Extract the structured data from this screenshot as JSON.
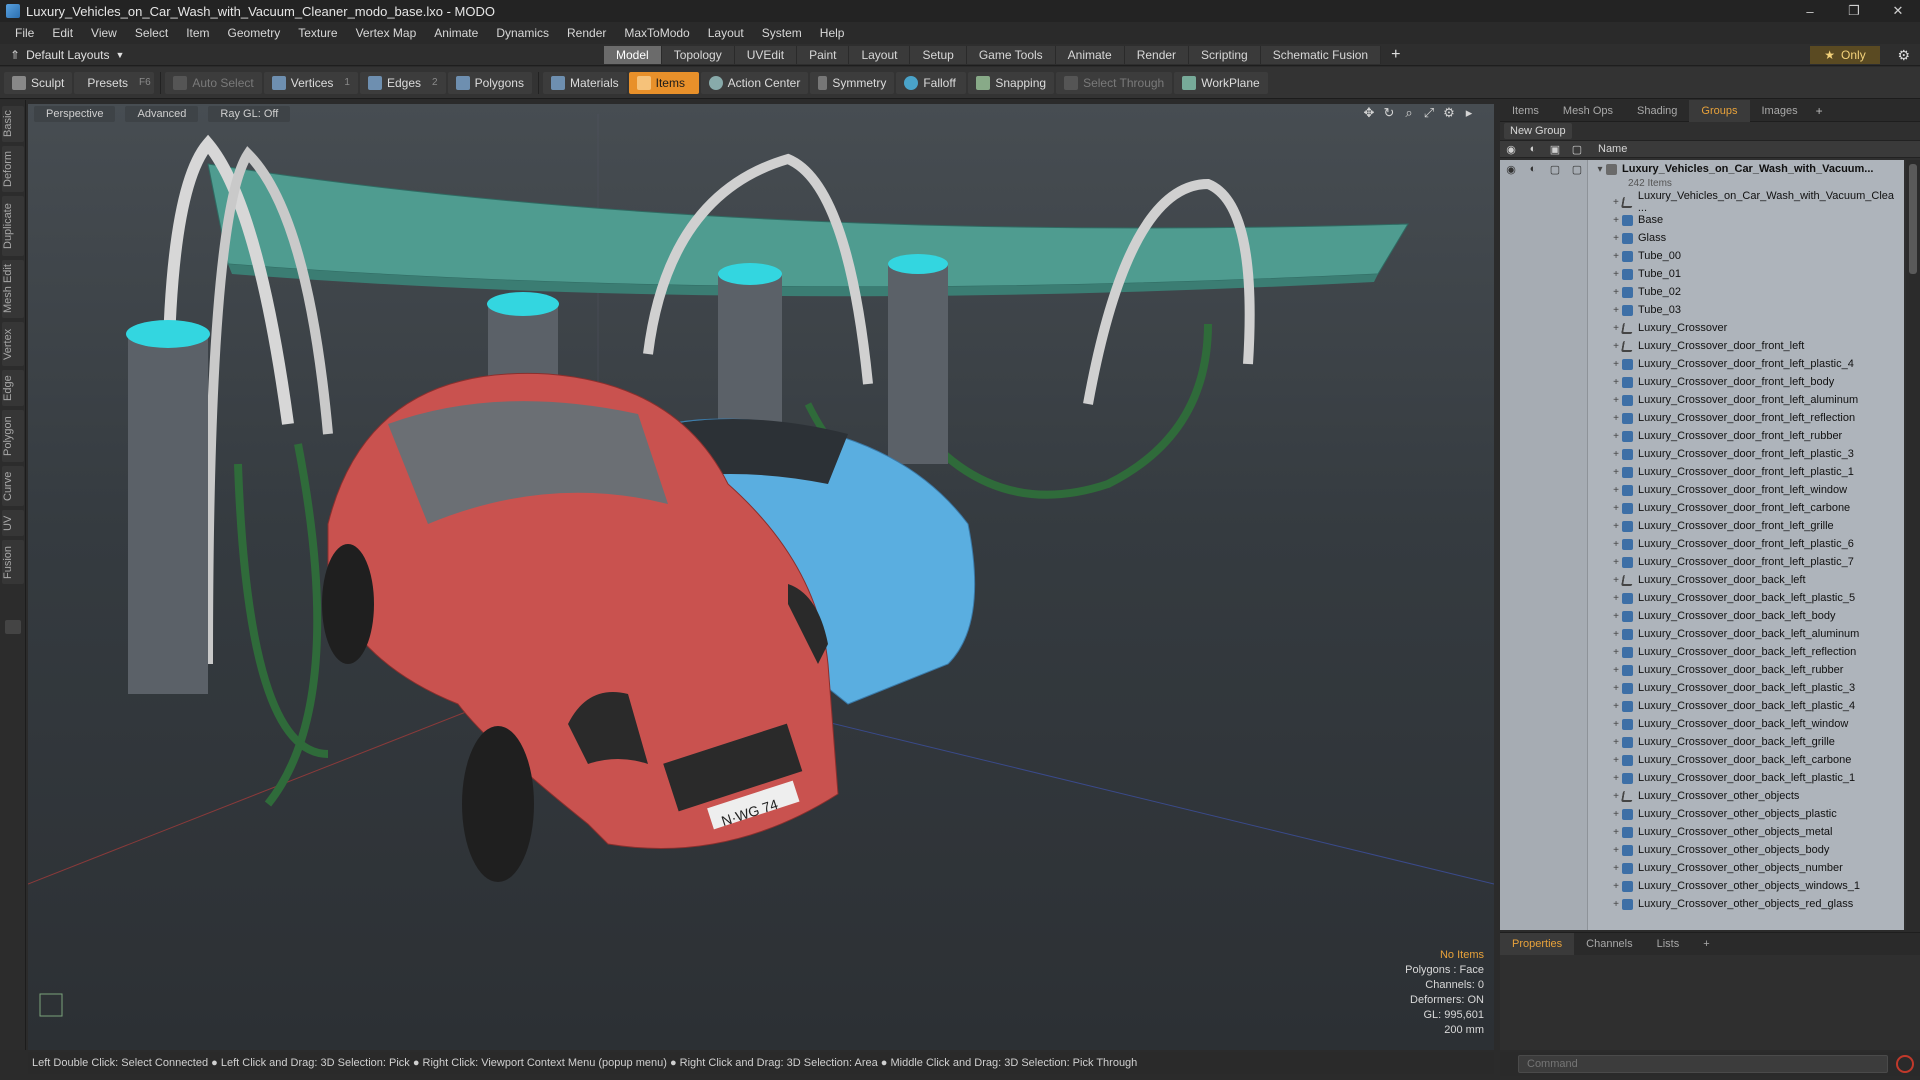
{
  "window": {
    "title": "Luxury_Vehicles_on_Car_Wash_with_Vacuum_Cleaner_modo_base.lxo - MODO",
    "controls": [
      "–",
      "❐",
      "✕"
    ]
  },
  "menu": [
    "File",
    "Edit",
    "View",
    "Select",
    "Item",
    "Geometry",
    "Texture",
    "Vertex Map",
    "Animate",
    "Dynamics",
    "Render",
    "MaxToModo",
    "Layout",
    "System",
    "Help"
  ],
  "layoutbar": {
    "layout_select": "Default Layouts",
    "tabs": [
      "Model",
      "Topology",
      "UVEdit",
      "Paint",
      "Layout",
      "Setup",
      "Game Tools",
      "Animate",
      "Render",
      "Scripting",
      "Schematic Fusion"
    ],
    "active_tab": "Model",
    "plus": "+",
    "only_label": "Only"
  },
  "toolbar": {
    "sculpt": "Sculpt",
    "presets": "Presets",
    "presets_key": "F6",
    "auto_select": "Auto Select",
    "vertices": "Vertices",
    "vertices_key": "1",
    "edges": "Edges",
    "edges_key": "2",
    "polygons": "Polygons",
    "materials": "Materials",
    "items": "Items",
    "action_center": "Action Center",
    "symmetry": "Symmetry",
    "falloff": "Falloff",
    "snapping": "Snapping",
    "select_through": "Select Through",
    "workplane": "WorkPlane"
  },
  "left_tabs": [
    "Basic",
    "Deform",
    "Duplicate",
    "Mesh Edit",
    "Vertex",
    "Edge",
    "Polygon",
    "Curve",
    "UV",
    "Fusion"
  ],
  "viewport": {
    "view_label": "Perspective",
    "shading_label": "Advanced",
    "raygl_label": "Ray GL: Off",
    "info": {
      "no_items": "No Items",
      "polygons": "Polygons : Face",
      "channels": "Channels: 0",
      "deformers": "Deformers: ON",
      "gl": "GL: 995,601",
      "scale": "200 mm"
    },
    "plate_text": "N·WG 74"
  },
  "status_bar": "Left Double Click: Select Connected ● Left Click and Drag: 3D Selection: Pick ● Right Click: Viewport Context Menu (popup menu) ● Right Click and Drag: 3D Selection: Area ● Middle Click and Drag: 3D Selection: Pick Through",
  "right_panel": {
    "tabs": [
      "Items",
      "Mesh Ops",
      "Shading",
      "Groups",
      "Images"
    ],
    "active_tab": "Groups",
    "new_group": "New Group",
    "column_name": "Name",
    "root": "Luxury_Vehicles_on_Car_Wash_with_Vacuum...",
    "root_count": "242 Items",
    "items": [
      {
        "name": "Luxury_Vehicles_on_Car_Wash_with_Vacuum_Clea ...",
        "type": "locator"
      },
      {
        "name": "Base",
        "type": "mesh"
      },
      {
        "name": "Glass",
        "type": "mesh"
      },
      {
        "name": "Tube_00",
        "type": "mesh"
      },
      {
        "name": "Tube_01",
        "type": "mesh"
      },
      {
        "name": "Tube_02",
        "type": "mesh"
      },
      {
        "name": "Tube_03",
        "type": "mesh"
      },
      {
        "name": "Luxury_Crossover",
        "type": "locator"
      },
      {
        "name": "Luxury_Crossover_door_front_left",
        "type": "locator"
      },
      {
        "name": "Luxury_Crossover_door_front_left_plastic_4",
        "type": "mesh"
      },
      {
        "name": "Luxury_Crossover_door_front_left_body",
        "type": "mesh"
      },
      {
        "name": "Luxury_Crossover_door_front_left_aluminum",
        "type": "mesh"
      },
      {
        "name": "Luxury_Crossover_door_front_left_reflection",
        "type": "mesh"
      },
      {
        "name": "Luxury_Crossover_door_front_left_rubber",
        "type": "mesh"
      },
      {
        "name": "Luxury_Crossover_door_front_left_plastic_3",
        "type": "mesh"
      },
      {
        "name": "Luxury_Crossover_door_front_left_plastic_1",
        "type": "mesh"
      },
      {
        "name": "Luxury_Crossover_door_front_left_window",
        "type": "mesh"
      },
      {
        "name": "Luxury_Crossover_door_front_left_carbone",
        "type": "mesh"
      },
      {
        "name": "Luxury_Crossover_door_front_left_grille",
        "type": "mesh"
      },
      {
        "name": "Luxury_Crossover_door_front_left_plastic_6",
        "type": "mesh"
      },
      {
        "name": "Luxury_Crossover_door_front_left_plastic_7",
        "type": "mesh"
      },
      {
        "name": "Luxury_Crossover_door_back_left",
        "type": "locator"
      },
      {
        "name": "Luxury_Crossover_door_back_left_plastic_5",
        "type": "mesh"
      },
      {
        "name": "Luxury_Crossover_door_back_left_body",
        "type": "mesh"
      },
      {
        "name": "Luxury_Crossover_door_back_left_aluminum",
        "type": "mesh"
      },
      {
        "name": "Luxury_Crossover_door_back_left_reflection",
        "type": "mesh"
      },
      {
        "name": "Luxury_Crossover_door_back_left_rubber",
        "type": "mesh"
      },
      {
        "name": "Luxury_Crossover_door_back_left_plastic_3",
        "type": "mesh"
      },
      {
        "name": "Luxury_Crossover_door_back_left_plastic_4",
        "type": "mesh"
      },
      {
        "name": "Luxury_Crossover_door_back_left_window",
        "type": "mesh"
      },
      {
        "name": "Luxury_Crossover_door_back_left_grille",
        "type": "mesh"
      },
      {
        "name": "Luxury_Crossover_door_back_left_carbone",
        "type": "mesh"
      },
      {
        "name": "Luxury_Crossover_door_back_left_plastic_1",
        "type": "mesh"
      },
      {
        "name": "Luxury_Crossover_other_objects",
        "type": "locator"
      },
      {
        "name": "Luxury_Crossover_other_objects_plastic",
        "type": "mesh"
      },
      {
        "name": "Luxury_Crossover_other_objects_metal",
        "type": "mesh"
      },
      {
        "name": "Luxury_Crossover_other_objects_body",
        "type": "mesh"
      },
      {
        "name": "Luxury_Crossover_other_objects_number",
        "type": "mesh"
      },
      {
        "name": "Luxury_Crossover_other_objects_windows_1",
        "type": "mesh"
      },
      {
        "name": "Luxury_Crossover_other_objects_red_glass",
        "type": "mesh"
      }
    ]
  },
  "properties_panel": {
    "tabs": [
      "Properties",
      "Channels",
      "Lists"
    ],
    "active_tab": "Properties",
    "plus": "+"
  },
  "command": {
    "placeholder": "Command"
  },
  "colors": {
    "accent": "#e8902a",
    "canopy": "#4f9c90",
    "red_car": "#c9524f",
    "blue_car": "#5aaee0",
    "hose": "#2f6b3a"
  }
}
